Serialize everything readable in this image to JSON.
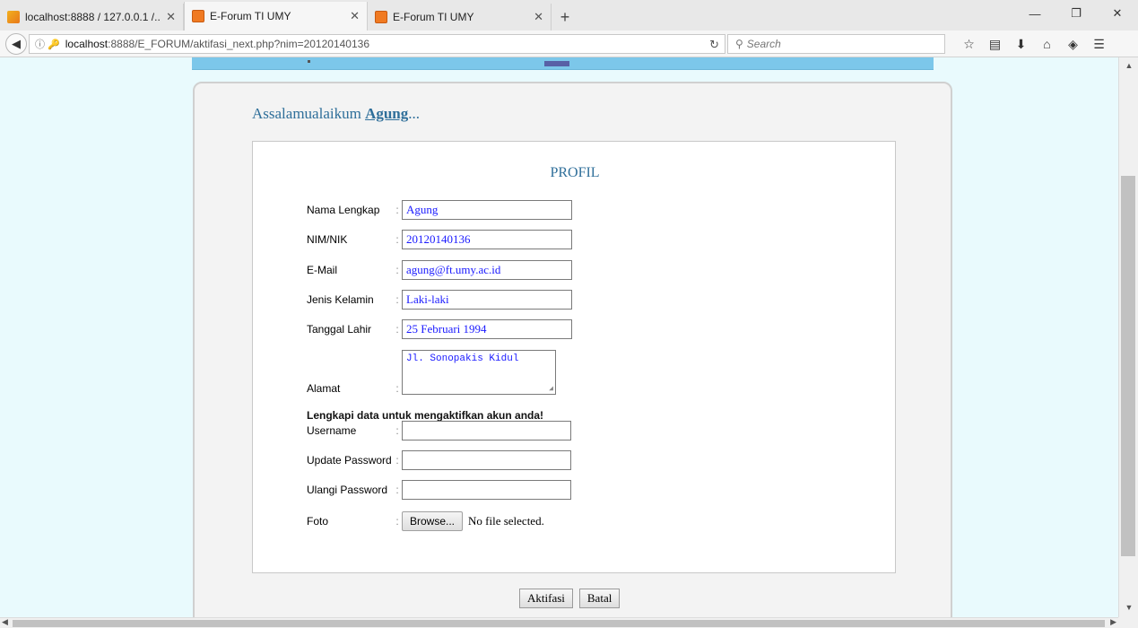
{
  "browser": {
    "tabs": [
      {
        "title": "localhost:8888 / 127.0.0.1 /...",
        "active": false
      },
      {
        "title": "E-Forum TI UMY",
        "active": true
      },
      {
        "title": "E-Forum TI UMY",
        "active": false
      }
    ],
    "url_host": "localhost",
    "url_rest": ":8888/E_FORUM/aktifasi_next.php?nim=20120140136",
    "search_placeholder": "Search"
  },
  "page": {
    "greeting_prefix": "Assalamualaikum ",
    "greeting_name": "Agung",
    "greeting_suffix": "...",
    "panel_title": "PROFIL",
    "fields": {
      "nama_label": "Nama Lengkap",
      "nama_value": "Agung",
      "nim_label": "NIM/NIK",
      "nim_value": "20120140136",
      "email_label": "E-Mail",
      "email_value": "agung@ft.umy.ac.id",
      "jk_label": "Jenis Kelamin",
      "jk_value": "Laki-laki",
      "tgl_label": "Tanggal Lahir",
      "tgl_value": "25 Februari 1994",
      "alamat_label": "Alamat",
      "alamat_value": "Jl. Sonopakis Kidul"
    },
    "note": "Lengkapi data untuk mengaktifkan akun anda!",
    "username_label": "Username",
    "password_label": "Update Password",
    "password2_label": "Ulangi Password",
    "foto_label": "Foto",
    "browse_label": "Browse...",
    "no_file": "No file selected.",
    "colon": ":",
    "aktifasi_label": "Aktifasi",
    "batal_label": "Batal"
  }
}
